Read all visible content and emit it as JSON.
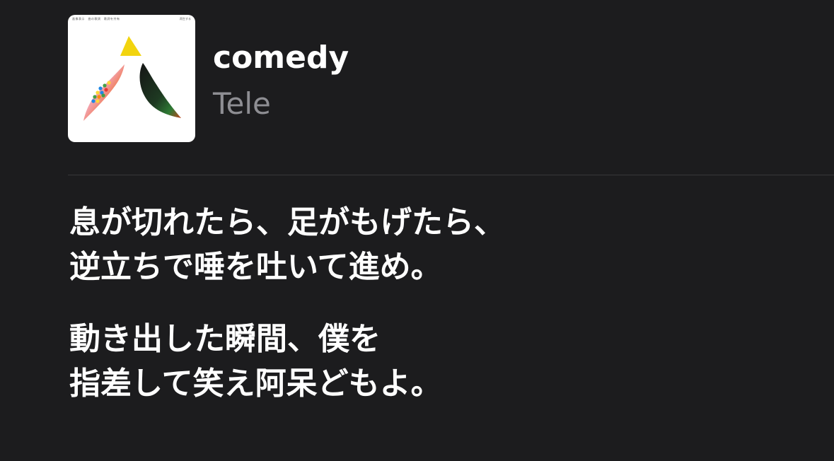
{
  "now_playing": {
    "album_art": {
      "caption_left": "画像表示　曲の歌詞　歌詞を共有",
      "caption_right": "再生する"
    },
    "title": "comedy",
    "artist": "Tele"
  },
  "lyrics": {
    "blocks": [
      {
        "lines": [
          "息が切れたら、足がもげたら、",
          "逆立ちで唾を吐いて進め。"
        ]
      },
      {
        "lines": [
          "動き出した瞬間、僕を",
          "指差して笑え阿呆どもよ。"
        ]
      }
    ]
  },
  "colors": {
    "background": "#1c1c1e",
    "title": "#ffffff",
    "artist": "#8e8e93",
    "lyrics": "#ffffff",
    "divider": "#38383a"
  }
}
